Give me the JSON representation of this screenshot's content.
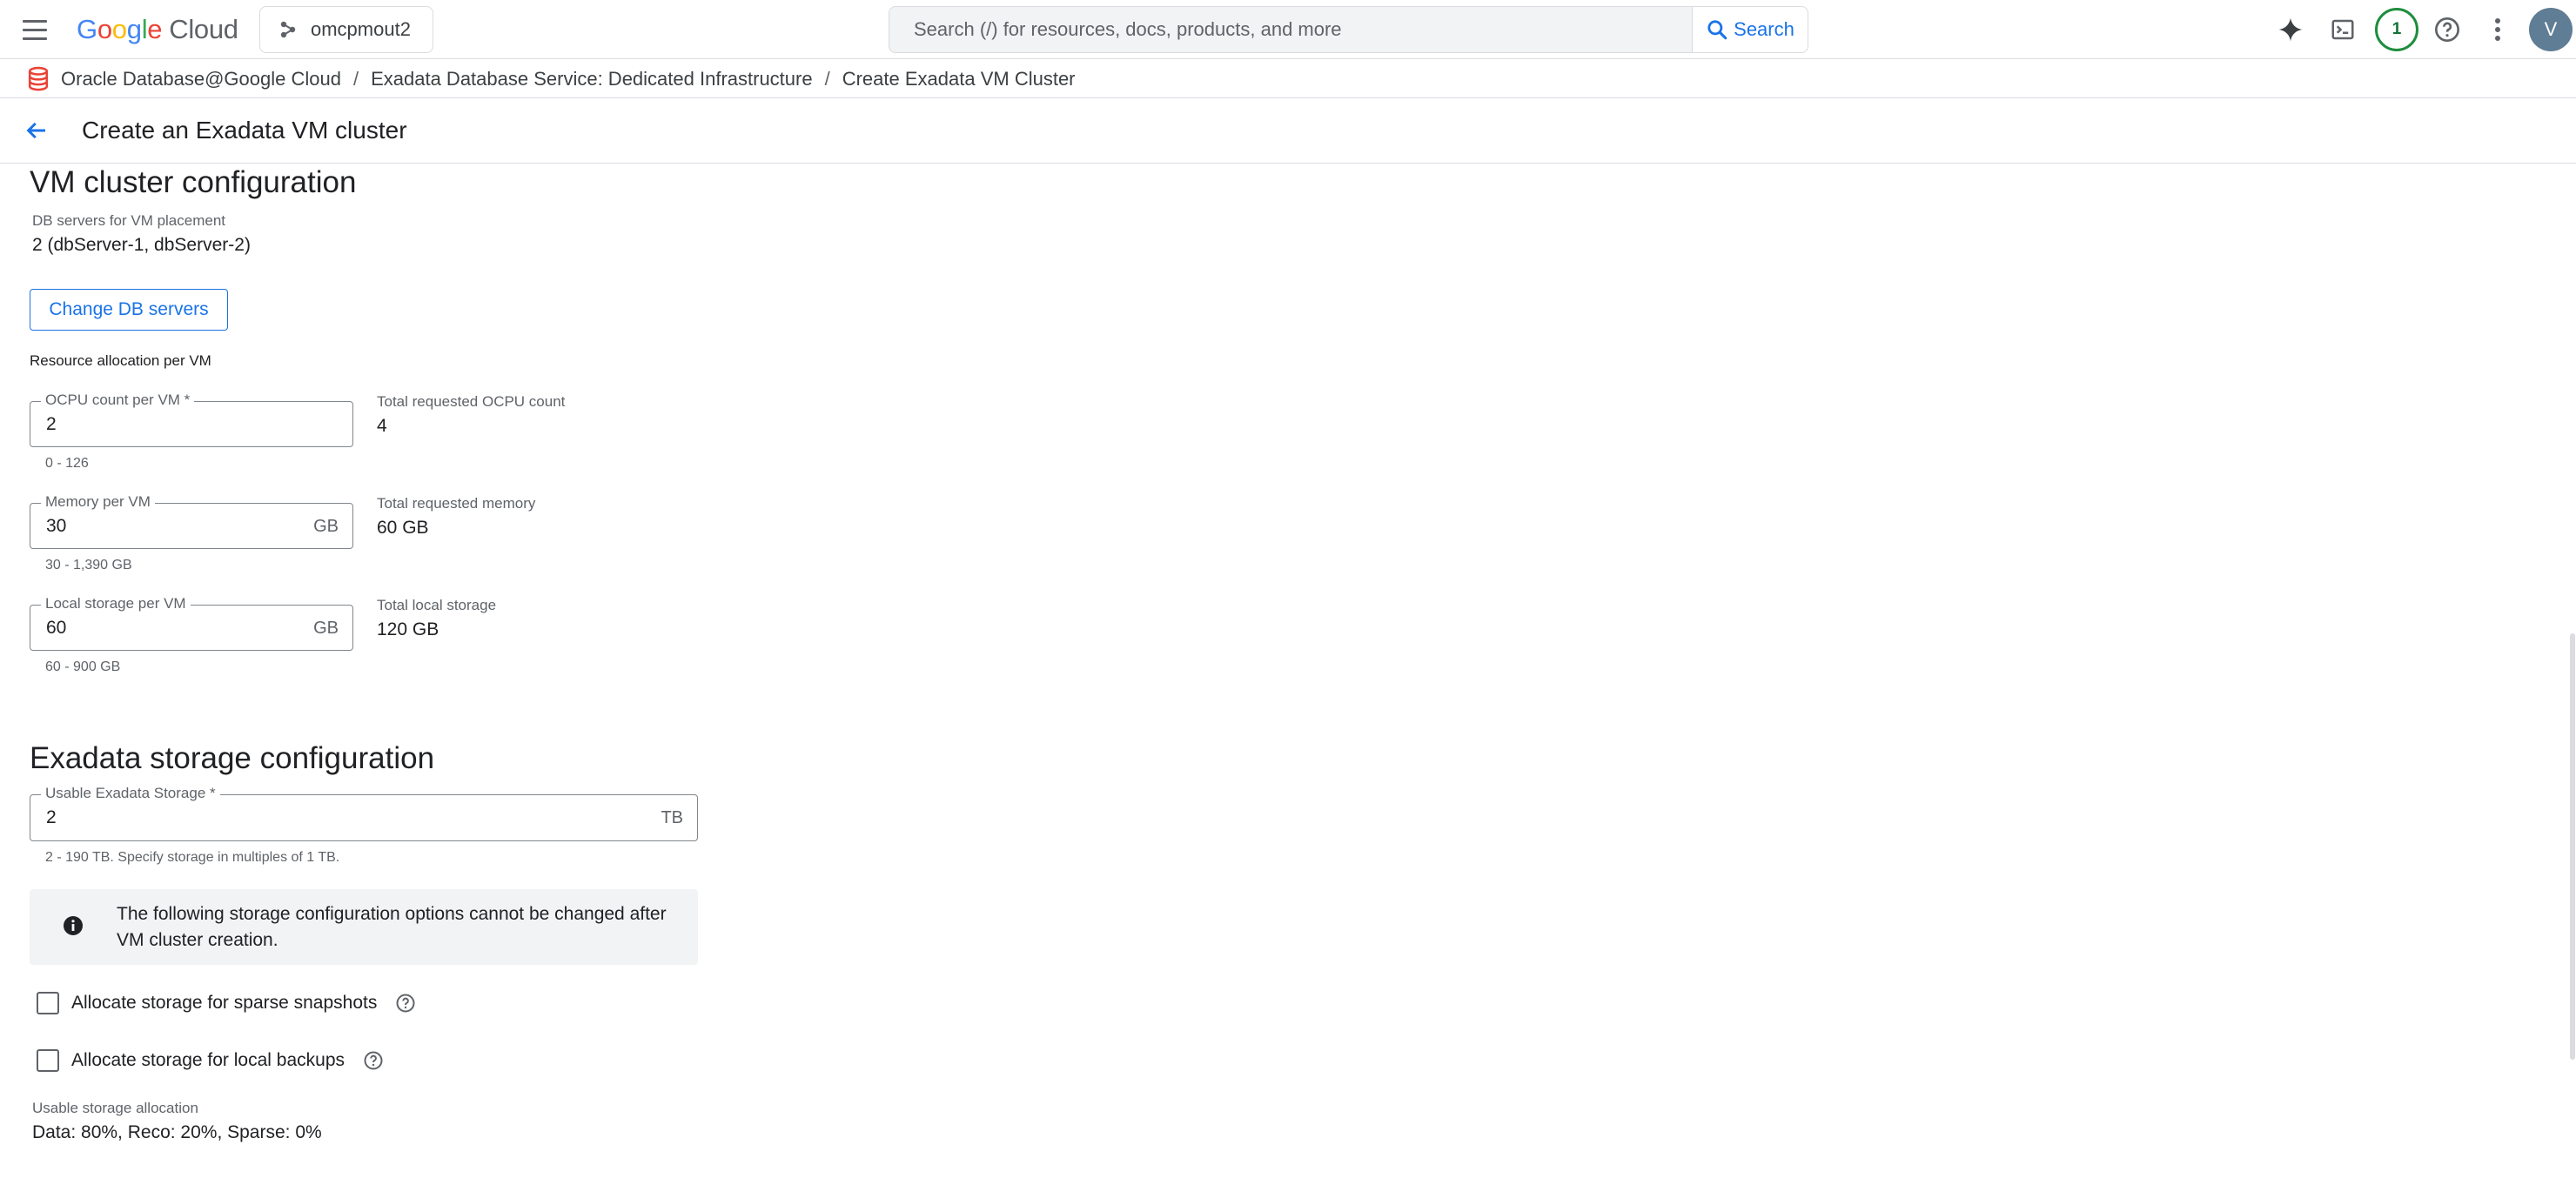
{
  "topbar": {
    "logo_google_letters": [
      "G",
      "o",
      "o",
      "g",
      "l",
      "e"
    ],
    "logo_colors": [
      "#4285f4",
      "#ea4335",
      "#fbbc04",
      "#4285f4",
      "#34a853",
      "#ea4335"
    ],
    "logo_product": "Cloud",
    "project_name": "omcpmout2",
    "search_placeholder": "Search (/) for resources, docs, products, and more",
    "search_button_label": "Search",
    "notification_count": "1",
    "avatar_initial": "V",
    "icons": [
      "menu-icon",
      "project-icon",
      "search-icon",
      "gemini-icon",
      "cloud-shell-icon",
      "help-icon",
      "more-vert-icon"
    ]
  },
  "breadcrumb": {
    "items": [
      "Oracle Database@Google Cloud",
      "Exadata Database Service: Dedicated Infrastructure",
      "Create Exadata VM Cluster"
    ],
    "separator": "/",
    "icon": "database-icon",
    "icon_color": "#ea4335"
  },
  "page": {
    "title": "Create an Exadata VM cluster"
  },
  "vm_cluster": {
    "heading": "VM cluster configuration",
    "db_servers_label": "DB servers for VM placement",
    "db_servers_value": "2 (dbServer-1, dbServer-2)",
    "change_button": "Change DB servers",
    "resource_label": "Resource allocation per VM",
    "ocpu": {
      "label": "OCPU count per VM *",
      "value": "2",
      "hint": "0 - 126",
      "total_label": "Total requested OCPU count",
      "total_value": "4"
    },
    "memory": {
      "label": "Memory per VM",
      "value": "30",
      "suffix": "GB",
      "hint": "30 - 1,390 GB",
      "total_label": "Total requested memory",
      "total_value": "60 GB"
    },
    "local_storage": {
      "label": "Local storage per VM",
      "value": "60",
      "suffix": "GB",
      "hint": "60 - 900 GB",
      "total_label": "Total local storage",
      "total_value": "120 GB"
    }
  },
  "exadata_storage": {
    "heading": "Exadata storage configuration",
    "usable": {
      "label": "Usable Exadata Storage *",
      "value": "2",
      "suffix": "TB",
      "hint": "2 - 190 TB. Specify storage in multiples of 1 TB."
    },
    "info_text": "The following storage configuration options cannot be changed after VM cluster creation.",
    "sparse_checkbox": {
      "label": "Allocate storage for sparse snapshots",
      "checked": false
    },
    "backup_checkbox": {
      "label": "Allocate storage for local backups",
      "checked": false
    },
    "allocation_label": "Usable storage allocation",
    "allocation_value": "Data: 80%, Reco: 20%, Sparse: 0%"
  },
  "colors": {
    "accent": "#1a73e8",
    "border": "#dadce0",
    "badge_green": "#1e8e3e",
    "avatar_bg": "#5f7d95",
    "info_bg": "#f1f3f4"
  }
}
